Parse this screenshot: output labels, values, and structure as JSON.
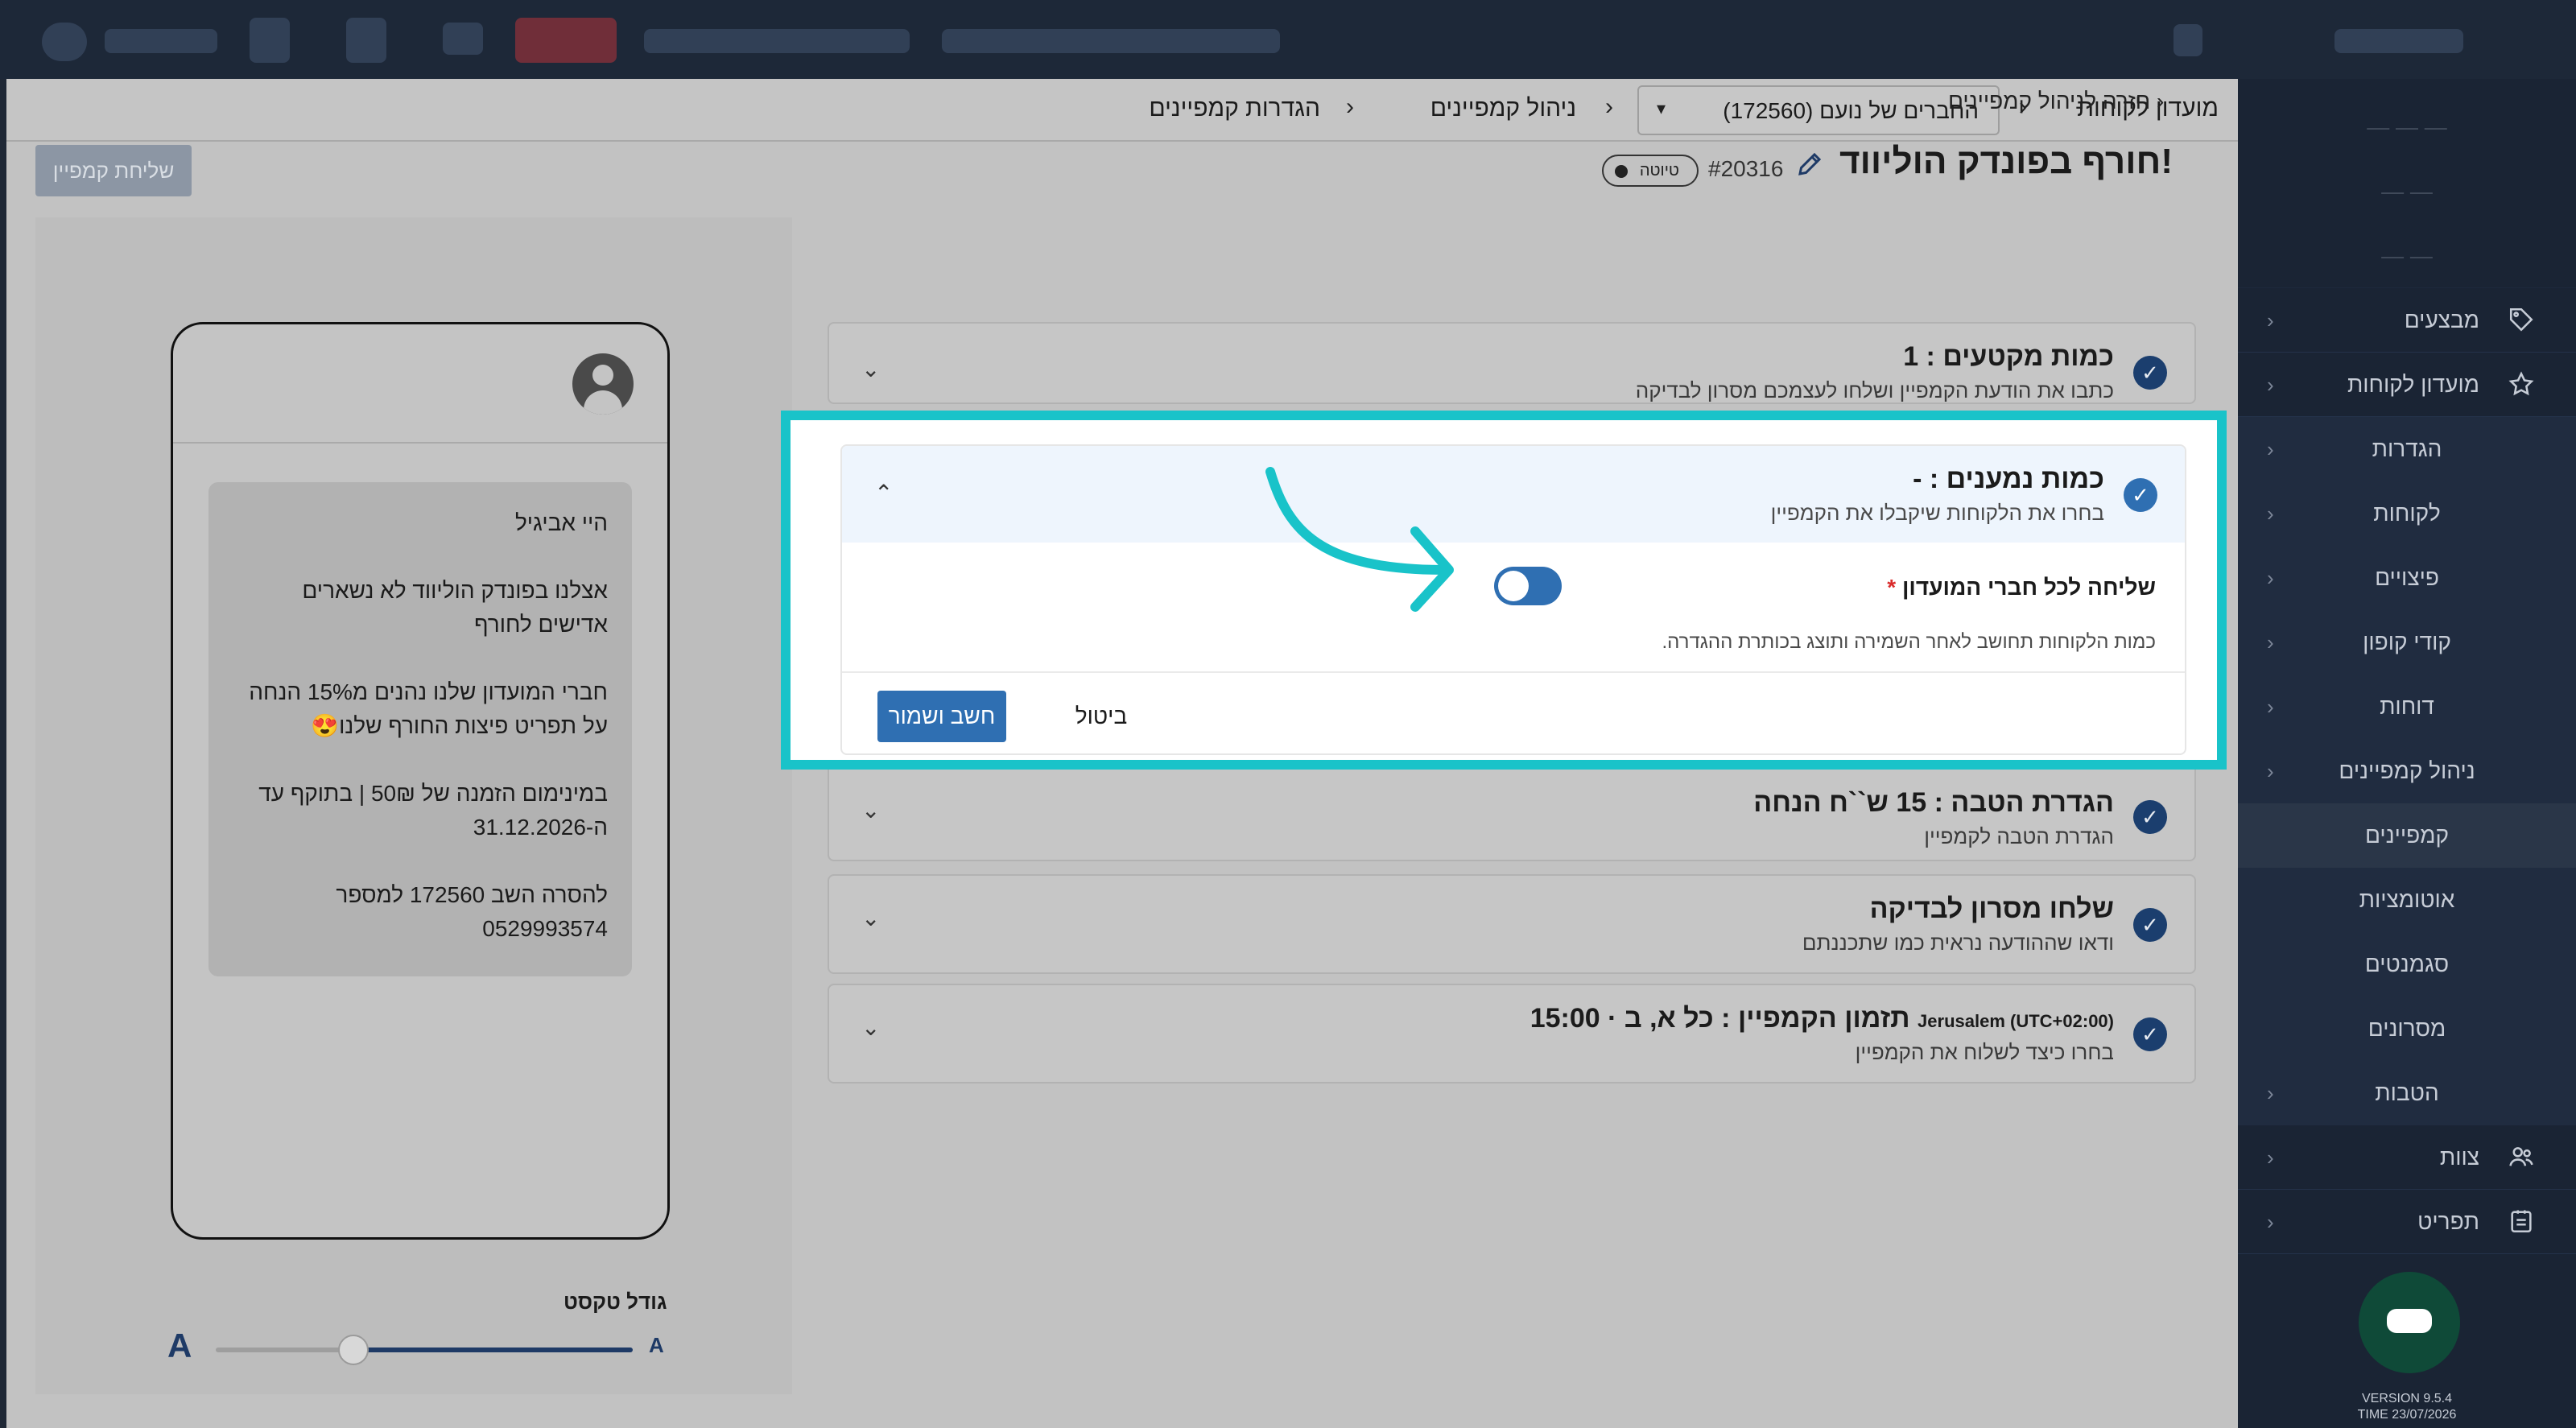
{
  "sidebar": {
    "items": [
      {
        "label": "מבצעים",
        "icon": "tag-icon"
      },
      {
        "label": "מועדון לקוחות",
        "icon": "star-icon"
      },
      {
        "label": "הגדרות"
      },
      {
        "label": "לקוחות"
      },
      {
        "label": "פיצויים"
      },
      {
        "label": "קודי קופון"
      },
      {
        "label": "דוחות"
      },
      {
        "label": "ניהול קמפיינים"
      },
      {
        "label": "קמפיינים"
      },
      {
        "label": "אוטומציות"
      },
      {
        "label": "סגמנטים"
      },
      {
        "label": "מסרונים"
      },
      {
        "label": "הטבות"
      },
      {
        "label": "צוות",
        "icon": "team-icon"
      },
      {
        "label": "תפריט",
        "icon": "menu-icon"
      }
    ],
    "version": "VERSION 9.5.4",
    "time": "TIME 23/07/2026"
  },
  "breadcrumb": {
    "root": "מועדון לקוחות",
    "club": "החברים של נועם (172560)",
    "section": "ניהול קמפיינים",
    "current": "הגדרות קמפיינים"
  },
  "page": {
    "back_link": "חזרה לניהול קמפיינים",
    "title": "חורף בפונדק הוליווד!",
    "campaign_id": "#20316",
    "status": "טיוטה",
    "send_button": "שליחת קמפיין"
  },
  "steps": [
    {
      "title": "כמות מקטעים : 1",
      "subtitle": "כתבו את הודעת הקמפיין ושלחו לעצמכם מסרון לבדיקה"
    },
    {
      "title": "הגדרת הטבה : 15 ש``ח הנחה",
      "subtitle": "הגדרת הטבה לקמפיין"
    },
    {
      "title": "שלחו מסרון לבדיקה",
      "subtitle": "ודאו שההודעה נראית כמו שתכננתם"
    },
    {
      "title": "תזמון הקמפיין : כל א, ב · 15:00",
      "timezone": "Jerusalem (UTC+02:00)",
      "subtitle": "בחרו כיצד לשלוח את הקמפיין"
    }
  ],
  "expanded_step": {
    "title": "כמות נמענים : -",
    "subtitle": "בחרו את הלקוחות שיקבלו את הקמפיין",
    "field_label": "שליחה לכל חברי המועדון",
    "required_mark": "*",
    "toggle_on": true,
    "help_note": "כמות הלקוחות תחושב לאחר השמירה ותוצג בכותרת ההגדרה.",
    "save_button": "חשב ושמור",
    "cancel_button": "ביטול"
  },
  "preview": {
    "messages": [
      "היי אביגיל",
      "אצלנו בפונדק הוליווד לא נשארים אדישים לחורף",
      "חברי המועדון שלנו נהנים מ15% הנחה על תפריט פיצות החורף שלנו😍",
      "במינימום הזמנה של 50₪ | בתוקף עד ה-31.12.2026",
      "להסרה השב 172560 למספר 0529993574"
    ],
    "font_size_label": "גודל טקסט",
    "font_small": "A",
    "font_big": "A",
    "font_level": 0.67
  },
  "colors": {
    "highlight": "#19c3c9",
    "primary": "#2f6fb2",
    "required": "#d92b2b"
  }
}
